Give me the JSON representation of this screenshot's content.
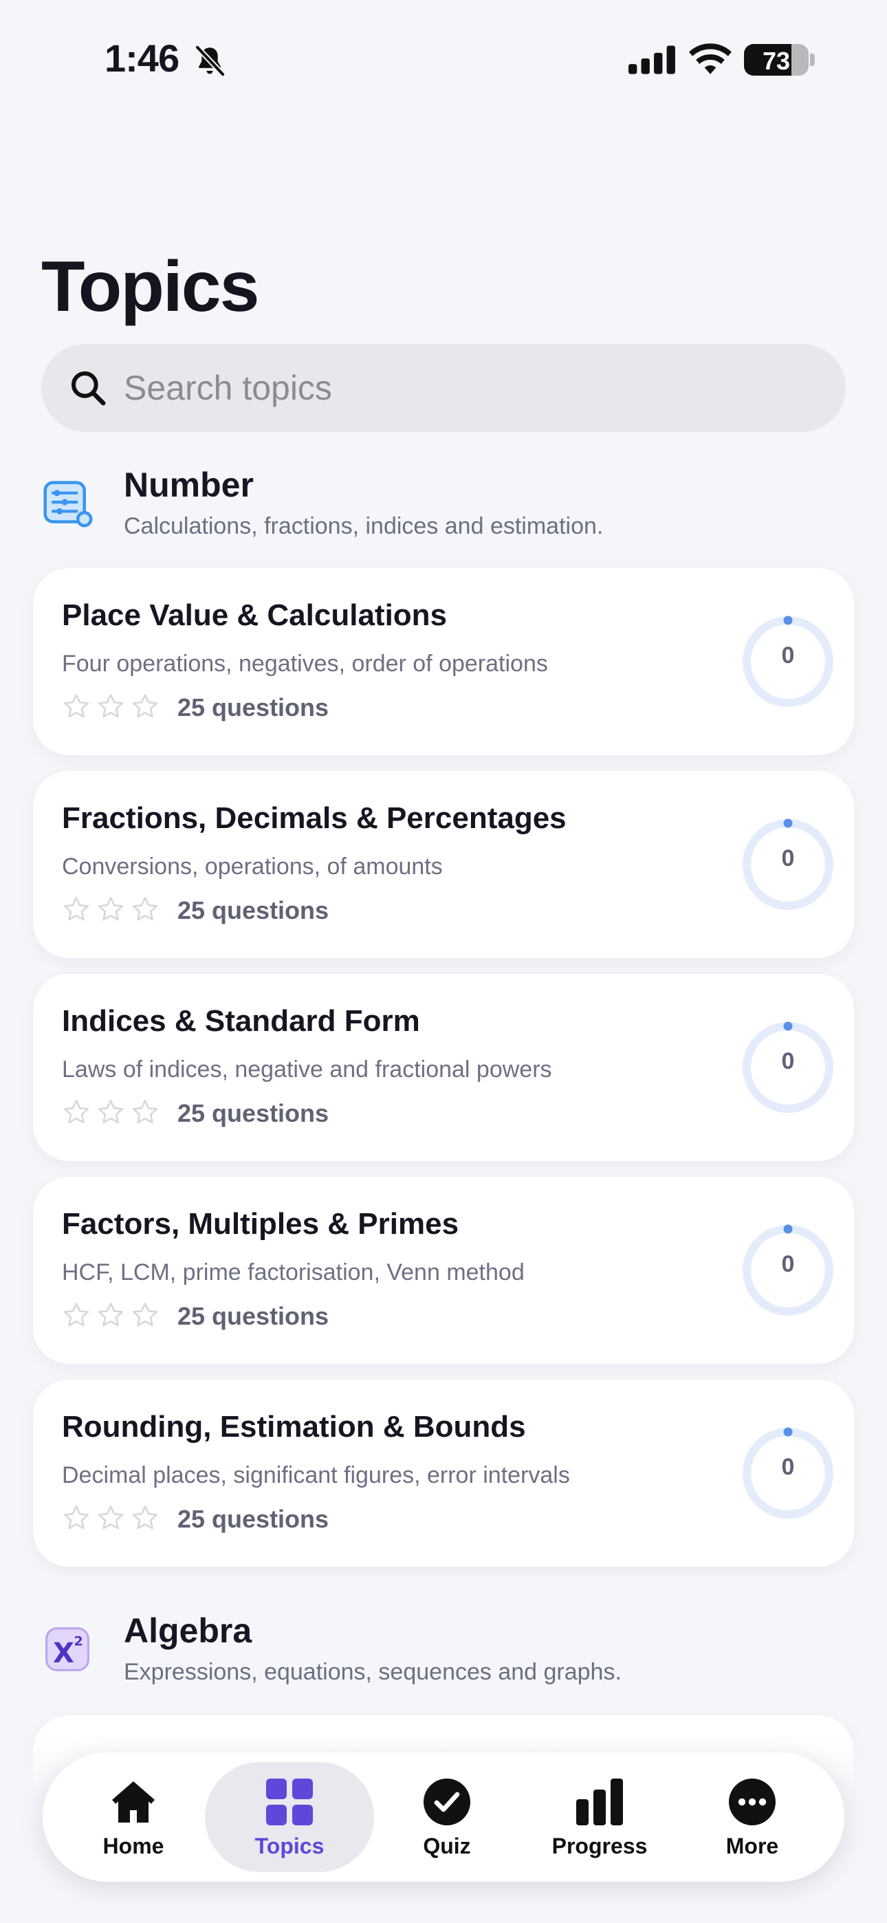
{
  "status_bar": {
    "time": "1:46",
    "battery": "73",
    "battery_level": 0.73
  },
  "header": {
    "title": "Topics"
  },
  "search": {
    "placeholder": "Search topics",
    "value": ""
  },
  "sections": [
    {
      "icon": "abacus-icon",
      "title": "Number",
      "subtitle": "Calculations, fractions, indices and estimation.",
      "topics": [
        {
          "title": "Place Value & Calculations",
          "description": "Four operations, negatives, order of operations",
          "stars": 0,
          "questions": "25 questions",
          "progress_value": "0",
          "progress": 0
        },
        {
          "title": "Fractions, Decimals & Percentages",
          "description": "Conversions, operations, of amounts",
          "stars": 0,
          "questions": "25 questions",
          "progress_value": "0",
          "progress": 0
        },
        {
          "title": "Indices & Standard Form",
          "description": "Laws of indices, negative and fractional powers",
          "stars": 0,
          "questions": "25 questions",
          "progress_value": "0",
          "progress": 0
        },
        {
          "title": "Factors, Multiples & Primes",
          "description": "HCF, LCM, prime factorisation, Venn method",
          "stars": 0,
          "questions": "25 questions",
          "progress_value": "0",
          "progress": 0
        },
        {
          "title": "Rounding, Estimation & Bounds",
          "description": "Decimal places, significant figures, error intervals",
          "stars": 0,
          "questions": "25 questions",
          "progress_value": "0",
          "progress": 0
        }
      ]
    },
    {
      "icon": "x-squared-icon",
      "title": "Algebra",
      "subtitle": "Expressions, equations, sequences and graphs.",
      "topics": []
    }
  ],
  "tab_bar": {
    "active": "Topics",
    "items": [
      {
        "label": "Home",
        "icon": "home-icon"
      },
      {
        "label": "Topics",
        "icon": "grid-icon"
      },
      {
        "label": "Quiz",
        "icon": "check-circle-icon"
      },
      {
        "label": "Progress",
        "icon": "bar-chart-icon"
      },
      {
        "label": "More",
        "icon": "more-icon"
      }
    ]
  },
  "colors": {
    "accent": "#5e48d9",
    "ring_track": "#e4ecfb",
    "ring_dot": "#5a8fe6",
    "background": "#f5f6fa"
  }
}
